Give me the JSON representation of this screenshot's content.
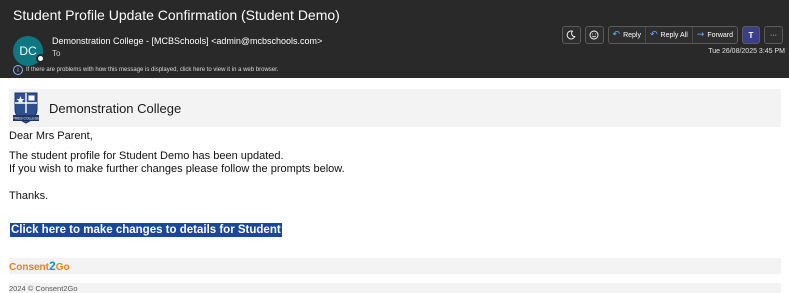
{
  "header": {
    "subject": "Student Profile Update Confirmation (Student Demo)",
    "avatar_initials": "DC",
    "sender": "Demonstration College - [MCBSchools] <admin@mcbschools.com>",
    "to_label": "To",
    "info_text": "If there are problems with how this message is displayed, click here to view it in a web browser.",
    "date": "Tue 26/08/2025 3:45 PM",
    "colors": {
      "background": "#292929",
      "avatar": "#0e7782",
      "accent": "#6aaeff"
    }
  },
  "toolbar": {
    "reply_label": "Reply",
    "reply_all_label": "Reply All",
    "forward_label": "Forward",
    "more_label": "···",
    "teams_label": "T",
    "icons": [
      "moon-icon",
      "emoji-icon",
      "reply-arrow-icon",
      "reply-all-arrow-icon",
      "forward-arrow-icon",
      "teams-icon",
      "more-icon"
    ]
  },
  "email": {
    "brand_name": "Demonstration College",
    "logo_caption": "PRIES COLLEGE",
    "greeting": "Dear Mrs Parent,",
    "line1": "The student profile for Student Demo has been updated.",
    "line2": "If you wish to make further changes please follow the prompts below.",
    "closing": "Thanks.",
    "cta_label": "Click here to make changes to details for Student",
    "cta_color": "#17489c"
  },
  "footer": {
    "logo_part1": "Consent",
    "logo_part2": "2",
    "logo_part3": "Go",
    "copyright": "2024 © Consent2Go",
    "colors": {
      "orange": "#f07e1c",
      "blue": "#1f8ed6"
    }
  }
}
